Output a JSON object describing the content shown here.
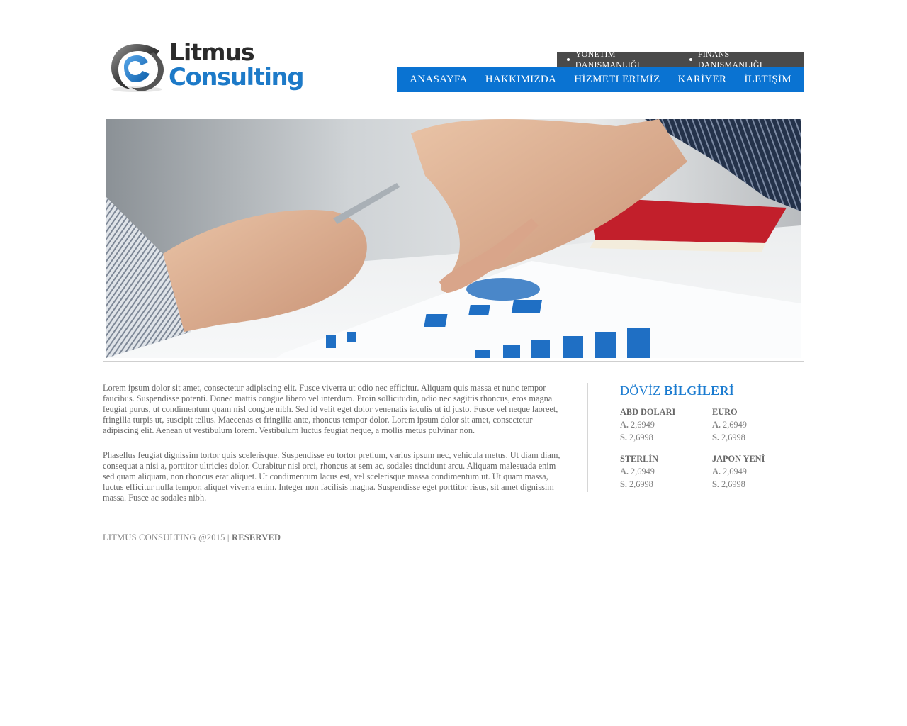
{
  "brand": {
    "line1": "Litmus",
    "line2": "Consulting",
    "colors": {
      "dark": "#2b2b2b",
      "blue": "#1d7ac8"
    }
  },
  "top_menu": [
    {
      "label": "YÖNETİM DANIŞMANLIĞI"
    },
    {
      "label": "FİNANS DANIŞMANLIĞI"
    }
  ],
  "main_nav": [
    {
      "label": "ANASAYFA"
    },
    {
      "label": "HAKKIMIZDA"
    },
    {
      "label": "HİZMETLERİMİZ"
    },
    {
      "label": "KARİYER"
    },
    {
      "label": "İLETİŞİM"
    }
  ],
  "hero": {
    "image": "business-analysis-photo"
  },
  "content": {
    "paragraphs": [
      "Lorem ipsum dolor sit amet, consectetur adipiscing elit. Fusce viverra ut odio nec efficitur. Aliquam quis massa et nunc tempor faucibus. Suspendisse potenti. Donec mattis congue libero vel interdum. Proin sollicitudin, odio nec sagittis rhoncus, eros magna feugiat purus, ut condimentum quam nisl congue nibh. Sed id velit eget dolor venenatis iaculis ut id justo. Fusce vel neque laoreet, fringilla turpis ut, suscipit tellus. Maecenas et fringilla ante, rhoncus tempor dolor. Lorem ipsum dolor sit amet, consectetur adipiscing elit. Aenean ut vestibulum lorem. Vestibulum luctus feugiat neque, a mollis metus pulvinar non.",
      "Phasellus feugiat dignissim tortor quis scelerisque. Suspendisse eu tortor pretium, varius ipsum nec, vehicula metus. Ut diam diam, consequat a nisi a, porttitor ultricies dolor. Curabitur nisl orci, rhoncus at sem ac, sodales tincidunt arcu. Aliquam malesuada enim sed quam aliquam, non rhoncus erat aliquet. Ut condimentum lacus est, vel scelerisque massa condimentum ut. Ut quam massa, luctus efficitur nulla tempor, aliquet viverra enim. Integer non facilisis magna. Suspendisse eget porttitor risus, sit amet dignissim massa. Fusce ac sodales nibh."
    ]
  },
  "fx": {
    "title_light": "DÖVİZ",
    "title_bold": "BİLGİLERİ",
    "buy_label": "A.",
    "sell_label": "S.",
    "currencies": [
      {
        "name": "ABD DOLARI",
        "buy": "2,6949",
        "sell": "2,6998"
      },
      {
        "name": "EURO",
        "buy": "2,6949",
        "sell": "2,6998"
      },
      {
        "name": "STERLİN",
        "buy": "2,6949",
        "sell": "2,6998"
      },
      {
        "name": "JAPON YENİ",
        "buy": "2,6949",
        "sell": "2,6998"
      }
    ]
  },
  "footer": {
    "text": "LITMUS CONSULTING @2015 |",
    "bold": "RESERVED"
  }
}
